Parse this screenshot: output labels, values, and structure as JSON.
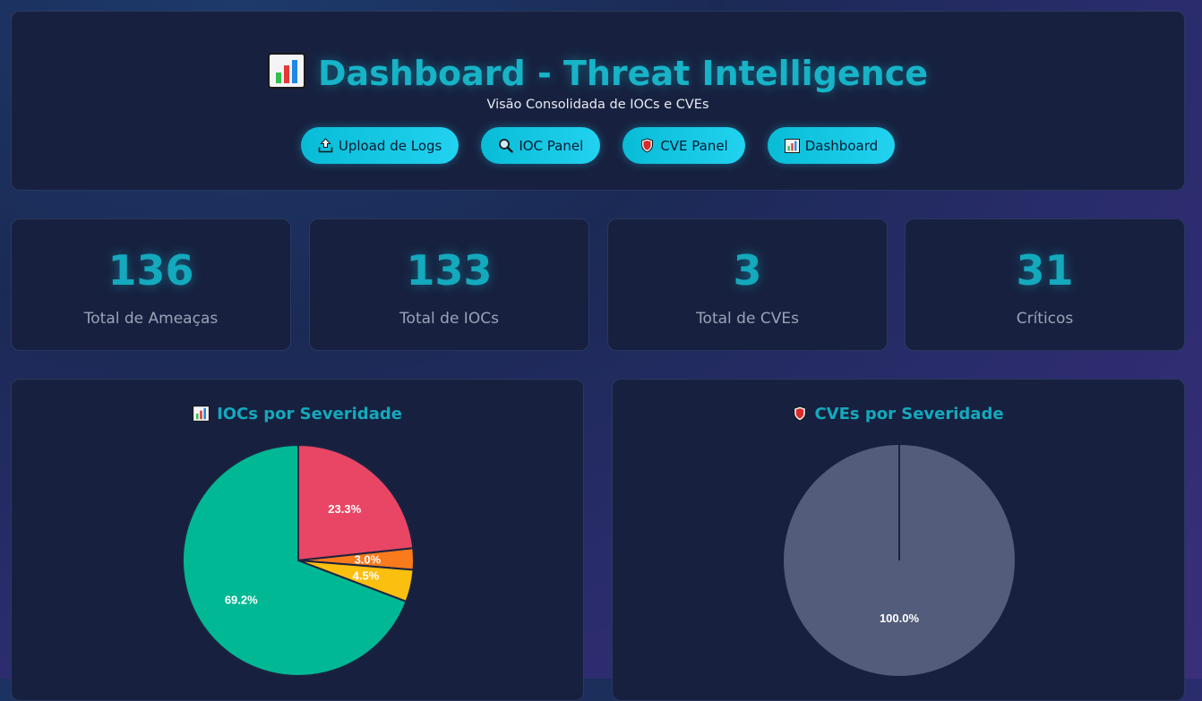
{
  "header": {
    "title": "Dashboard - Threat Intelligence",
    "subtitle": "Visão Consolidada de IOCs e CVEs",
    "nav": [
      {
        "label": "Upload de Logs",
        "icon": "upload-icon"
      },
      {
        "label": "IOC Panel",
        "icon": "magnifier-icon"
      },
      {
        "label": "CVE Panel",
        "icon": "shield-icon"
      },
      {
        "label": "Dashboard",
        "icon": "bar-chart-icon"
      }
    ]
  },
  "stats": [
    {
      "value": "136",
      "label": "Total de Ameaças"
    },
    {
      "value": "133",
      "label": "Total de IOCs"
    },
    {
      "value": "3",
      "label": "Total de CVEs"
    },
    {
      "value": "31",
      "label": "Críticos"
    }
  ],
  "colors": {
    "accent": "#14a9bd",
    "button": "#0fc6e0",
    "card_bg": "#17213f",
    "critical": "#e84664",
    "high": "#f97b1c",
    "medium": "#fbbf10",
    "low": "#00b894",
    "unknown": "#535c7b"
  },
  "chart_data": [
    {
      "type": "pie",
      "title": "IOCs por Severidade",
      "values": [
        23.3,
        3.0,
        4.5,
        69.2
      ],
      "labels": [
        "23.3%",
        "3.0%",
        "4.5%",
        "69.2%"
      ],
      "colors": [
        "#e84664",
        "#f97b1c",
        "#fbbf10",
        "#00b894"
      ]
    },
    {
      "type": "pie",
      "title": "CVEs por Severidade",
      "values": [
        100.0
      ],
      "labels": [
        "100.0%"
      ],
      "colors": [
        "#535c7b"
      ]
    }
  ]
}
